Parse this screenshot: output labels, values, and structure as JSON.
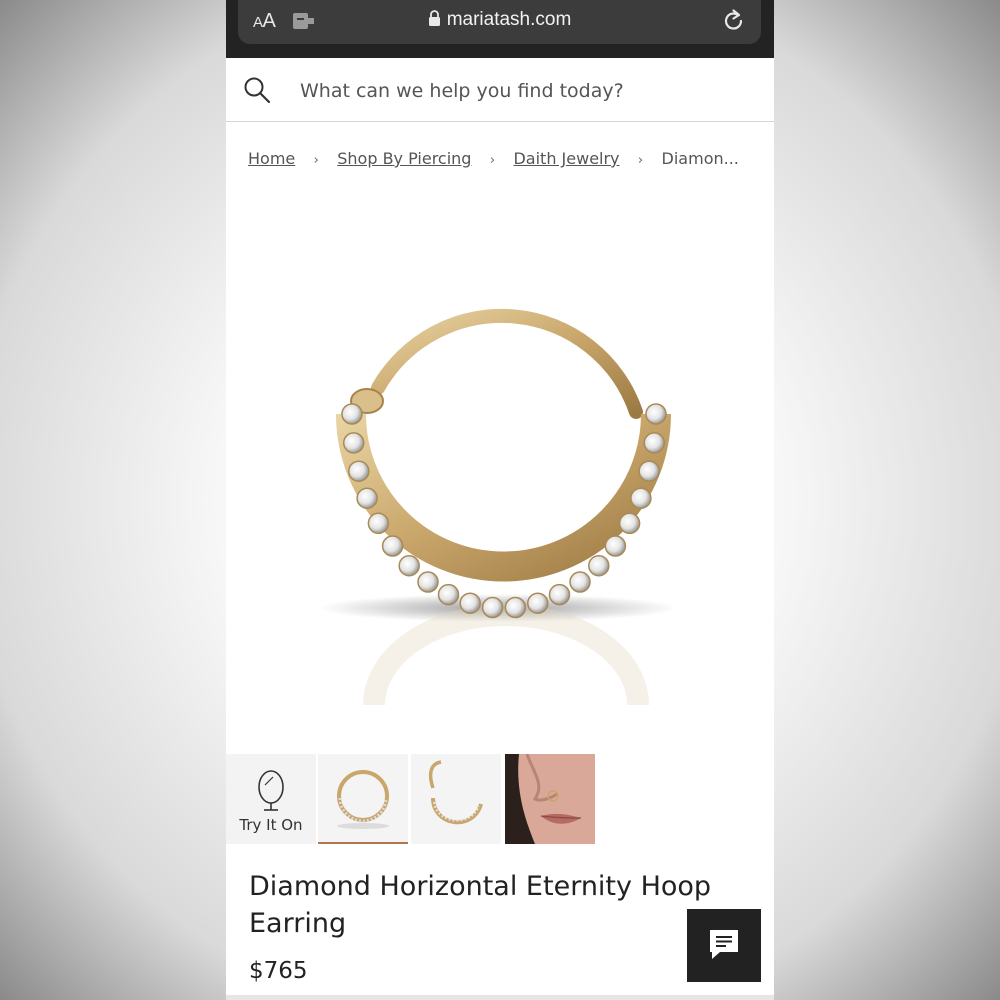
{
  "browser": {
    "text_size_small": "A",
    "text_size_large": "A",
    "url": "mariatash.com",
    "icons": [
      "text-size-icon",
      "extension-icon",
      "lock-icon",
      "reload-icon"
    ]
  },
  "search": {
    "placeholder": "What can we help you find today?",
    "icon": "search-icon"
  },
  "breadcrumb": {
    "items": [
      {
        "label": "Home"
      },
      {
        "label": "Shop By Piercing"
      },
      {
        "label": "Daith Jewelry"
      }
    ],
    "current": "Diamon...",
    "separator": "›"
  },
  "thumbnails": {
    "try_it_on_label": "Try It On",
    "selected_index": 1
  },
  "product": {
    "title": "Diamond Horizontal Eternity Hoop Earring",
    "price": "$765"
  },
  "chat": {
    "icon": "chat-icon"
  },
  "colors": {
    "accent_underline": "#b3754f",
    "gold": "#c9a66b",
    "browser_bar": "#232323",
    "chat_button": "#222222"
  }
}
